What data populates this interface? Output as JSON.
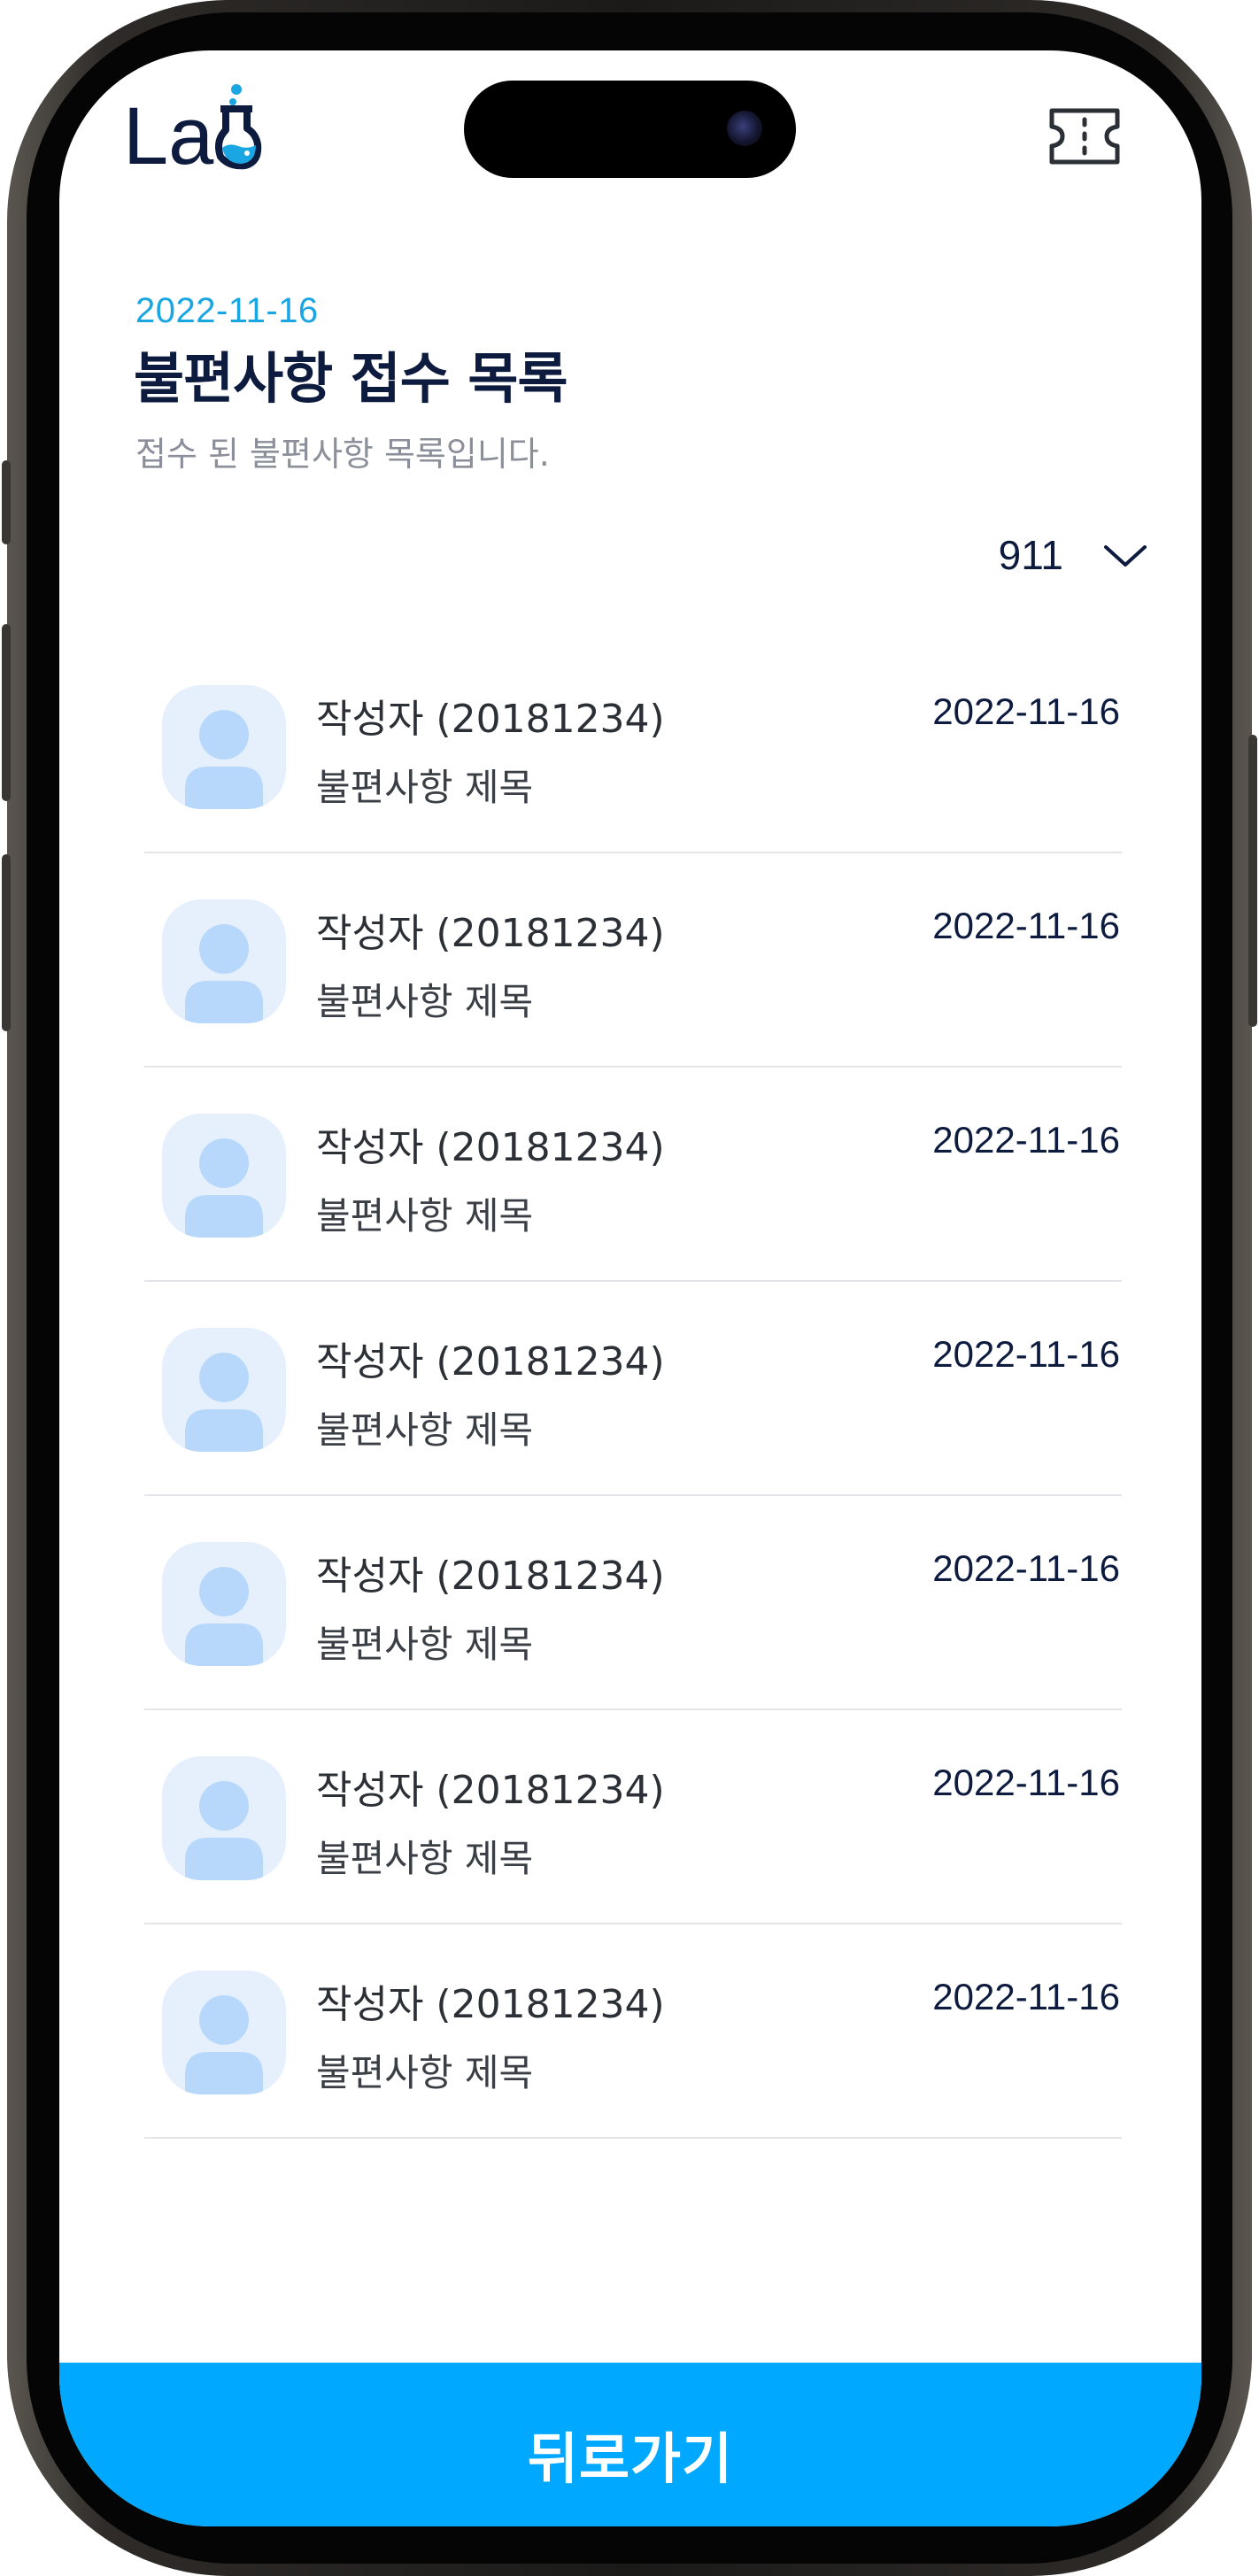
{
  "header": {
    "logo_text": "Lab",
    "ticket_icon": "ticket-icon"
  },
  "page": {
    "date": "2022-11-16",
    "title": "불편사항 접수 목록",
    "subtitle": "접수 된 불편사항 목록입니다."
  },
  "filter": {
    "selected": "911",
    "icon": "chevron-down-icon"
  },
  "complaints": [
    {
      "author": "작성자 (20181234)",
      "title": "불편사항 제목",
      "date": "2022-11-16"
    },
    {
      "author": "작성자 (20181234)",
      "title": "불편사항 제목",
      "date": "2022-11-16"
    },
    {
      "author": "작성자 (20181234)",
      "title": "불편사항 제목",
      "date": "2022-11-16"
    },
    {
      "author": "작성자 (20181234)",
      "title": "불편사항 제목",
      "date": "2022-11-16"
    },
    {
      "author": "작성자 (20181234)",
      "title": "불편사항 제목",
      "date": "2022-11-16"
    },
    {
      "author": "작성자 (20181234)",
      "title": "불편사항 제목",
      "date": "2022-11-16"
    },
    {
      "author": "작성자 (20181234)",
      "title": "불편사항 제목",
      "date": "2022-11-16"
    }
  ],
  "footer": {
    "back_label": "뒤로가기"
  },
  "colors": {
    "accent": "#00a8ff",
    "date_accent": "#1aa6e3",
    "title": "#0d1b3e",
    "avatar_bg": "#e6f0fd",
    "avatar_fg": "#b8d8fb"
  }
}
